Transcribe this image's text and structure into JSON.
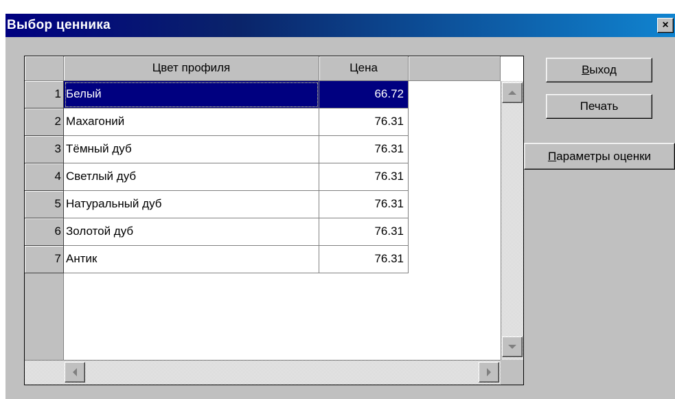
{
  "window": {
    "title": "Выбор ценника",
    "close_glyph": "×"
  },
  "grid": {
    "columns": [
      "Цвет профиля",
      "Цена"
    ],
    "selected_row": 0,
    "rows": [
      {
        "num": "1",
        "name": "Белый",
        "price": "66.72"
      },
      {
        "num": "2",
        "name": "Махагоний",
        "price": "76.31"
      },
      {
        "num": "3",
        "name": "Тёмный дуб",
        "price": "76.31"
      },
      {
        "num": "4",
        "name": "Светлый дуб",
        "price": "76.31"
      },
      {
        "num": "5",
        "name": "Натуральный дуб",
        "price": "76.31"
      },
      {
        "num": "6",
        "name": "Золотой дуб",
        "price": "76.31"
      },
      {
        "num": "7",
        "name": "Антик",
        "price": "76.31"
      }
    ]
  },
  "buttons": {
    "exit": {
      "accel": "В",
      "rest": "ыход"
    },
    "print": {
      "label": "Печать"
    },
    "params": {
      "accel": "П",
      "rest": "араметры оценки"
    }
  },
  "colors": {
    "selection": "#000080",
    "titlebar": "#000080",
    "face": "#c0c0c0"
  },
  "icons": [
    "close-icon",
    "scroll-up-icon",
    "scroll-down-icon",
    "scroll-left-icon",
    "scroll-right-icon"
  ]
}
